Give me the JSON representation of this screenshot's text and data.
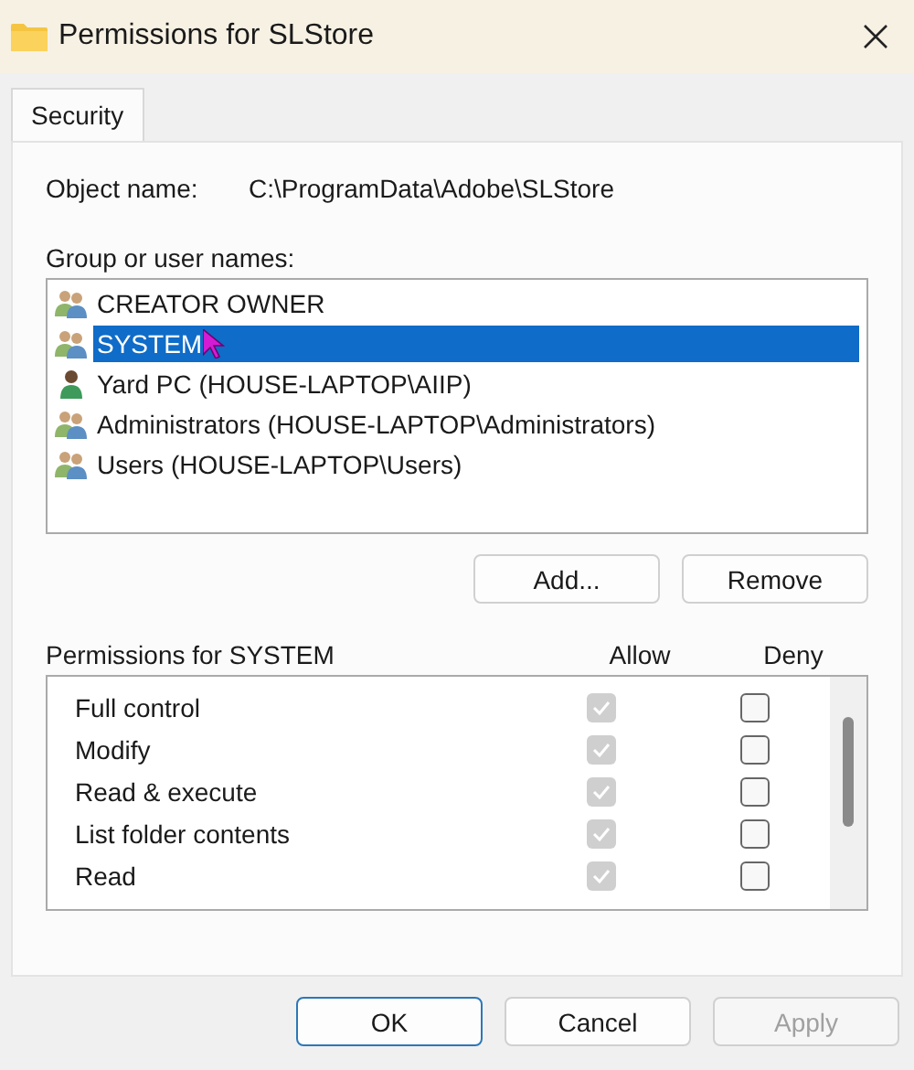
{
  "window": {
    "title": "Permissions for SLStore"
  },
  "tabs": [
    {
      "label": "Security",
      "selected": true
    }
  ],
  "object": {
    "label": "Object name:",
    "value": "C:\\ProgramData\\Adobe\\SLStore"
  },
  "group_label": "Group or user names:",
  "users": [
    {
      "name": "CREATOR OWNER",
      "kind": "group",
      "selected": false
    },
    {
      "name": "SYSTEM",
      "kind": "group",
      "selected": true
    },
    {
      "name": "Yard PC (HOUSE-LAPTOP\\AIIP)",
      "kind": "user",
      "selected": false
    },
    {
      "name": "Administrators (HOUSE-LAPTOP\\Administrators)",
      "kind": "group",
      "selected": false
    },
    {
      "name": "Users (HOUSE-LAPTOP\\Users)",
      "kind": "group",
      "selected": false
    }
  ],
  "list_buttons": [
    "Add...",
    "Remove"
  ],
  "permissions": {
    "title": "Permissions for SYSTEM",
    "allow_label": "Allow",
    "deny_label": "Deny",
    "rows": [
      {
        "name": "Full control",
        "allow": true,
        "allow_disabled": true,
        "deny": false
      },
      {
        "name": "Modify",
        "allow": true,
        "allow_disabled": true,
        "deny": false
      },
      {
        "name": "Read & execute",
        "allow": true,
        "allow_disabled": true,
        "deny": false
      },
      {
        "name": "List folder contents",
        "allow": true,
        "allow_disabled": true,
        "deny": false
      },
      {
        "name": "Read",
        "allow": true,
        "allow_disabled": true,
        "deny": false
      }
    ]
  },
  "buttons": [
    {
      "label": "OK",
      "kind": "default",
      "disabled": false
    },
    {
      "label": "Cancel",
      "kind": "normal",
      "disabled": false
    },
    {
      "label": "Apply",
      "kind": "normal",
      "disabled": true
    }
  ]
}
